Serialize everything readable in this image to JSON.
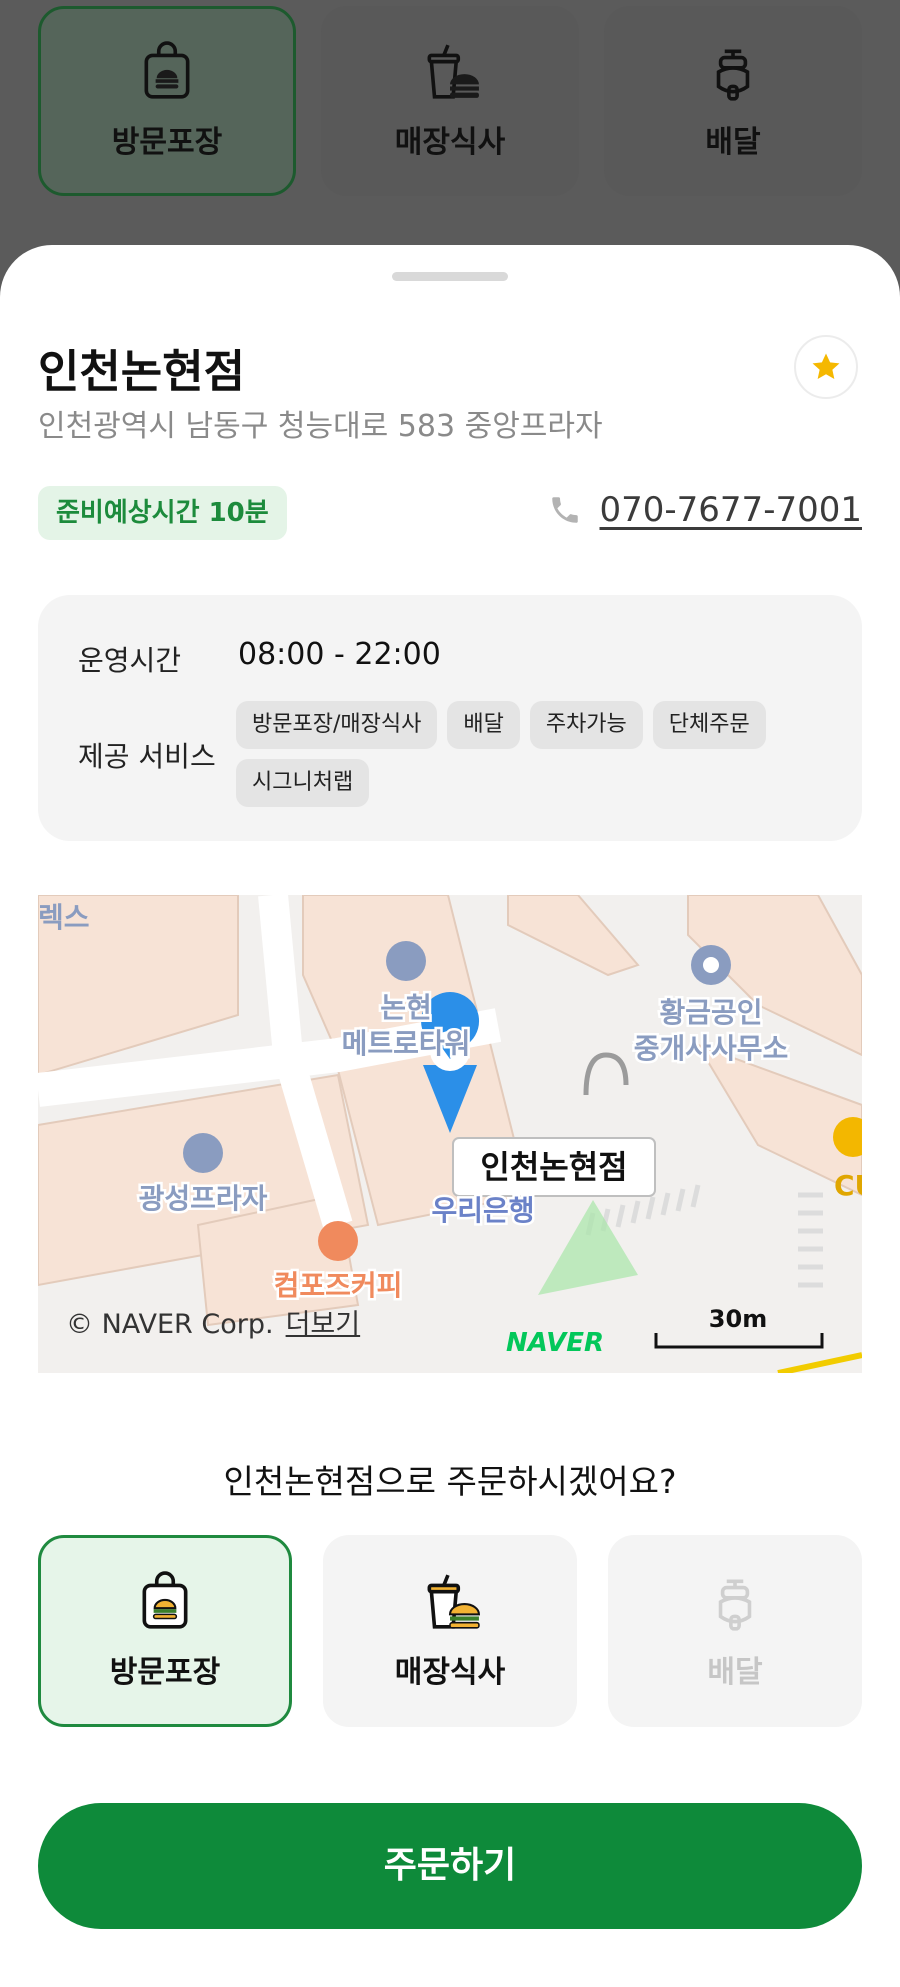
{
  "background_order_types": [
    {
      "label": "방문포장",
      "icon": "takeout-bag-icon",
      "selected": true
    },
    {
      "label": "매장식사",
      "icon": "dine-in-icon",
      "selected": false
    },
    {
      "label": "배달",
      "icon": "delivery-scooter-icon",
      "selected": false
    }
  ],
  "store": {
    "name": "인천논현점",
    "address": "인천광역시 남동구 청능대로 583 중앙프라자",
    "prep_time": "준비예상시간 10분",
    "phone": "070-7677-7001",
    "favorite_icon": "star-icon"
  },
  "info": {
    "hours_label": "운영시간",
    "hours": "08:00 - 22:00",
    "services_label": "제공 서비스",
    "services": [
      "방문포장/매장식사",
      "배달",
      "주차가능",
      "단체주문",
      "시그니처랩"
    ]
  },
  "map": {
    "labels": {
      "nonhyeon_metro_1": "논현",
      "nonhyeon_metro_2": "메트로타워",
      "realtor_1": "황금공인",
      "realtor_2": "중개사사무소",
      "gwangseong": "광성프라자",
      "woori": "우리은행",
      "compose": "컴포즈커피",
      "store_marker": "인천논현점",
      "edge_top": "렉스",
      "cu": "CU",
      "naver": "NAVER",
      "scale": "30m"
    },
    "copyright": "© NAVER Corp.",
    "more": "더보기"
  },
  "question": "인천논현점으로 주문하시겠어요?",
  "order_types": [
    {
      "label": "방문포장",
      "icon": "takeout-bag-icon",
      "selected": true,
      "disabled": false
    },
    {
      "label": "매장식사",
      "icon": "dine-in-icon",
      "selected": false,
      "disabled": false
    },
    {
      "label": "배달",
      "icon": "delivery-scooter-icon",
      "selected": false,
      "disabled": true
    }
  ],
  "order_button": "주문하기",
  "colors": {
    "accent": "#0e8a3a",
    "badge_text": "#1c8b3c",
    "star": "#f5b800"
  }
}
